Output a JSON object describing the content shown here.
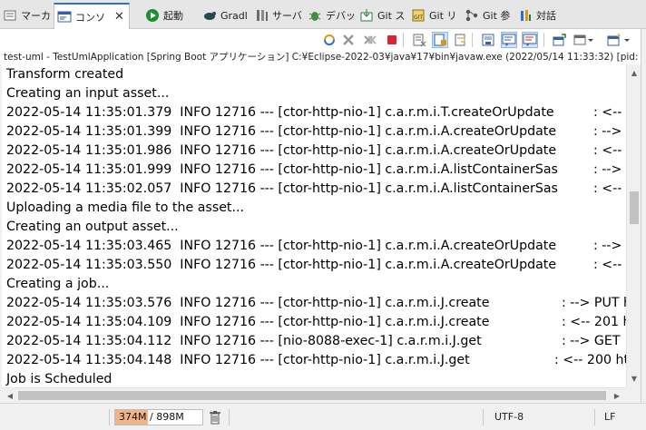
{
  "tabs": [
    {
      "label": "マーカ",
      "icon": "markers-icon"
    },
    {
      "label": "コンソ",
      "icon": "console-icon",
      "active": true,
      "close": "✕"
    },
    {
      "label": "起動",
      "icon": "launch-icon"
    },
    {
      "label": "Gradl",
      "icon": "gradle-icon"
    },
    {
      "label": "サーバ",
      "icon": "servers-icon"
    },
    {
      "label": "デバッ",
      "icon": "debug-icon"
    },
    {
      "label": "Git ス",
      "icon": "git-staging-icon"
    },
    {
      "label": "Git リ",
      "icon": "git-repositories-icon"
    },
    {
      "label": "Git 参",
      "icon": "git-reflog-icon"
    },
    {
      "label": "対話",
      "icon": "interactive-icon"
    }
  ],
  "process_line": "test-uml - TestUmlApplication [Spring Boot アプリケーション] C:¥Eclipse-2022-03¥java¥17¥bin¥javaw.exe  (2022/05/14 11:33:32) [pid: 12716",
  "console_lines": [
    {
      "text": "Transform created",
      "suffix": ""
    },
    {
      "text": "Creating an input asset...",
      "suffix": ""
    },
    {
      "text": "2022-05-14 11:35:01.379  INFO 12716 --- [ctor-http-nio-1] c.a.r.m.i.T.createOrUpdate",
      "suffix": ": <--"
    },
    {
      "text": "2022-05-14 11:35:01.399  INFO 12716 --- [ctor-http-nio-1] c.a.r.m.i.A.createOrUpdate",
      "suffix": ": -->"
    },
    {
      "text": "2022-05-14 11:35:01.986  INFO 12716 --- [ctor-http-nio-1] c.a.r.m.i.A.createOrUpdate",
      "suffix": ": <--"
    },
    {
      "text": "2022-05-14 11:35:01.999  INFO 12716 --- [ctor-http-nio-1] c.a.r.m.i.A.listContainerSas",
      "suffix": ": -->"
    },
    {
      "text": "2022-05-14 11:35:02.057  INFO 12716 --- [ctor-http-nio-1] c.a.r.m.i.A.listContainerSas",
      "suffix": ": <--"
    },
    {
      "text": "Uploading a media file to the asset...",
      "suffix": ""
    },
    {
      "text": "Creating an output asset...",
      "suffix": ""
    },
    {
      "text": "2022-05-14 11:35:03.465  INFO 12716 --- [ctor-http-nio-1] c.a.r.m.i.A.createOrUpdate",
      "suffix": ": -->"
    },
    {
      "text": "2022-05-14 11:35:03.550  INFO 12716 --- [ctor-http-nio-1] c.a.r.m.i.A.createOrUpdate",
      "suffix": ": <--"
    },
    {
      "text": "Creating a job...",
      "suffix": ""
    },
    {
      "text": "2022-05-14 11:35:03.576  INFO 12716 --- [ctor-http-nio-1] c.a.r.m.i.J.create",
      "suffix": ": --> PUT h"
    },
    {
      "text": "2022-05-14 11:35:04.109  INFO 12716 --- [ctor-http-nio-1] c.a.r.m.i.J.create",
      "suffix": ": <-- 201 h"
    },
    {
      "text": "2022-05-14 11:35:04.112  INFO 12716 --- [nio-8088-exec-1] c.a.r.m.i.J.get",
      "suffix": ": --> GET"
    },
    {
      "text": "2022-05-14 11:35:04.148  INFO 12716 --- [ctor-http-nio-1] c.a.r.m.i.J.get",
      "suffix": ": <-- 200 ht"
    },
    {
      "text": "Job is Scheduled",
      "suffix": ""
    }
  ],
  "status": {
    "memory_used": "374M",
    "memory_separator": " / ",
    "memory_total": "898M",
    "memory_fraction": 0.4165,
    "encoding": "UTF-8",
    "line_delimiter": "LF"
  },
  "colors": {
    "active_tab_accent": "#2f6fd1",
    "heap_fill": "#f2b486",
    "terminate_red": "#d9262b",
    "launch_green": "#1e8f2e"
  }
}
